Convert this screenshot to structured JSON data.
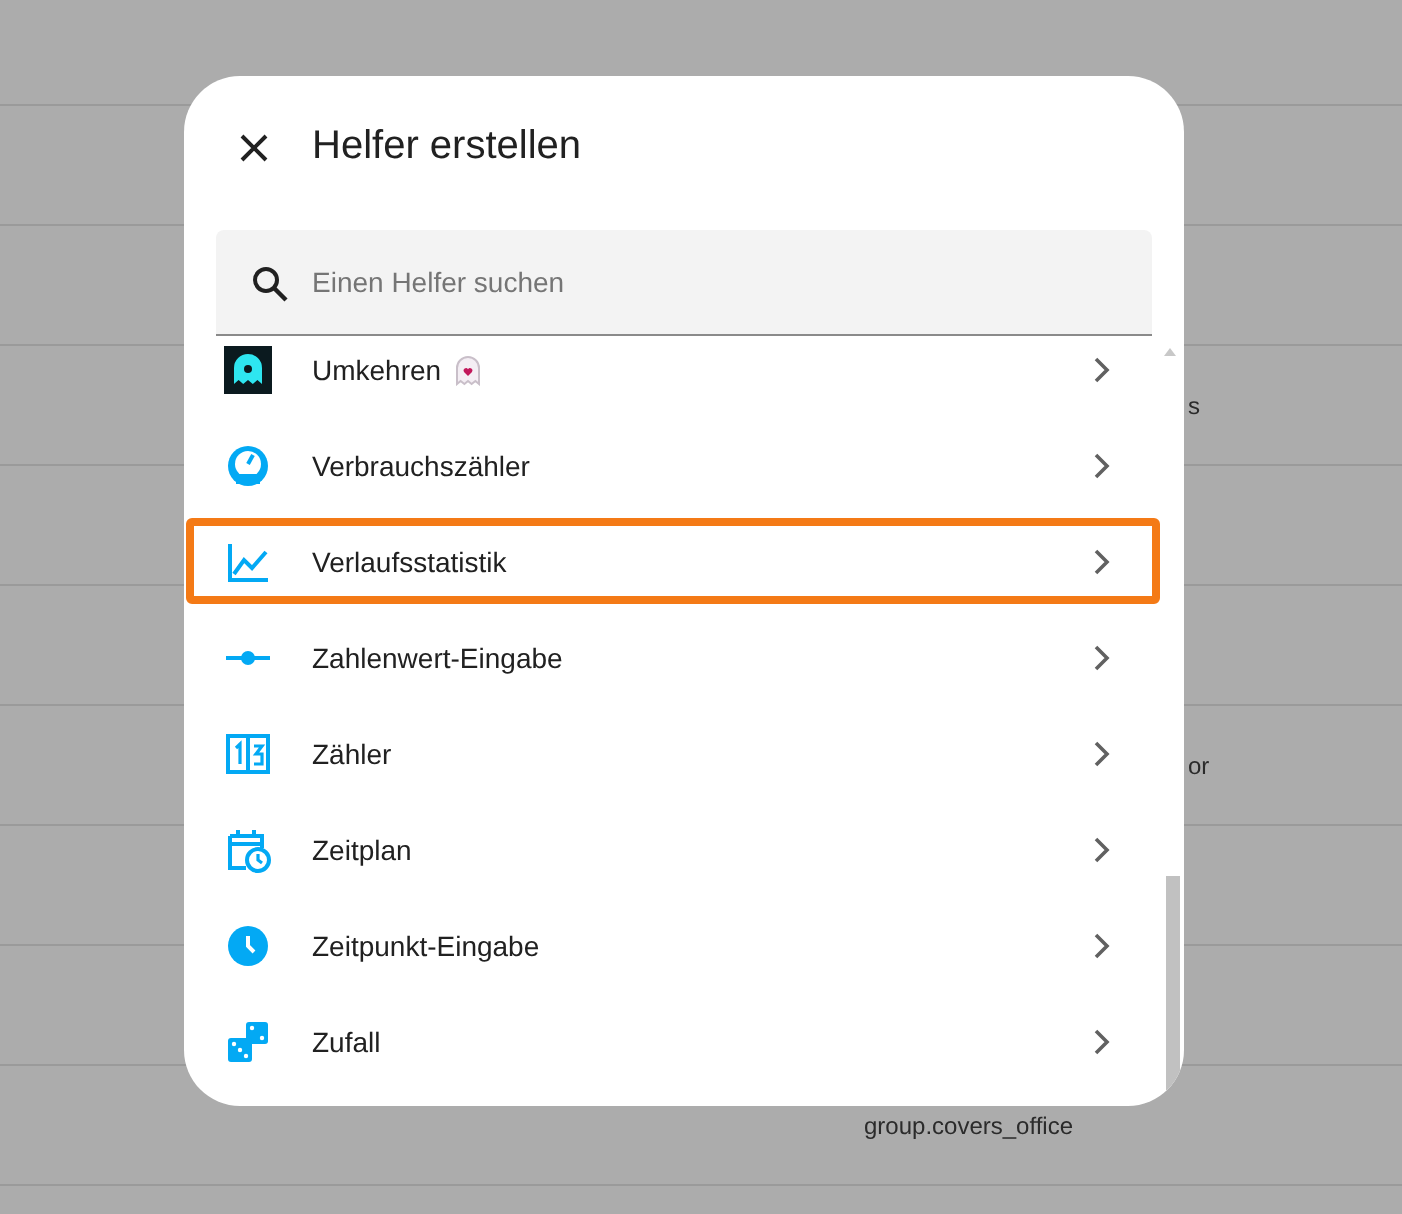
{
  "background_table": {
    "rows": [
      {},
      {},
      {
        "column_3": "s"
      },
      {},
      {},
      {
        "column_3": "or"
      },
      {},
      {},
      {
        "column_2": "group.covers_office"
      },
      {}
    ]
  },
  "dialog": {
    "title": "Helfer erstellen",
    "search": {
      "placeholder": "Einen Helfer suchen"
    },
    "items": [
      {
        "kind": "ghost",
        "label": "Umkehren",
        "badge": true,
        "highlighted": false
      },
      {
        "kind": "gauge",
        "label": "Verbrauchszähler",
        "badge": false,
        "highlighted": false
      },
      {
        "kind": "chart",
        "label": "Verlaufsstatistik",
        "badge": false,
        "highlighted": true
      },
      {
        "kind": "slider",
        "label": "Zahlenwert-Eingabe",
        "badge": false,
        "highlighted": false
      },
      {
        "kind": "counter",
        "label": "Zähler",
        "badge": false,
        "highlighted": false
      },
      {
        "kind": "calendar",
        "label": "Zeitplan",
        "badge": false,
        "highlighted": false
      },
      {
        "kind": "clock",
        "label": "Zeitpunkt-Eingabe",
        "badge": false,
        "highlighted": false
      },
      {
        "kind": "dice",
        "label": "Zufall",
        "badge": false,
        "highlighted": false
      }
    ]
  }
}
